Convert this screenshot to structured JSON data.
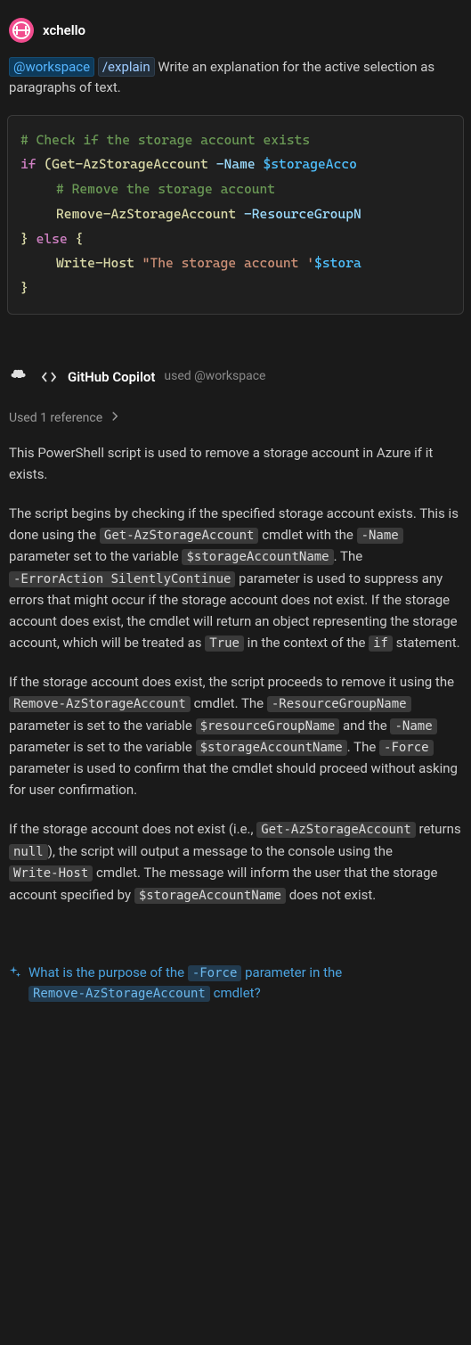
{
  "user": {
    "name": "xchello"
  },
  "prompt": {
    "workspace_tag": "@workspace",
    "slash_tag": "/explain",
    "text_after": " Write an explanation for the active selection as paragraphs of text."
  },
  "code": {
    "line1_comment": "# Check if the storage account exists",
    "line2_if": "if",
    "line2_open": " (",
    "line2_cmd": "Get-AzStorageAccount",
    "line2_param": " -Name ",
    "line2_var": "$storageAcco",
    "line3_comment": "# Remove the storage account",
    "line4_cmd": "Remove-AzStorageAccount",
    "line4_param": " -ResourceGroupN",
    "line5_close": "}",
    "line5_else": " else ",
    "line5_open": "{",
    "line6_cmd": "Write-Host",
    "line6_str_a": " \"The storage account '",
    "line6_var": "$stora",
    "line7_close": "}"
  },
  "copilot": {
    "name": "GitHub Copilot",
    "used": "used @workspace",
    "references": "Used 1 reference"
  },
  "explanation": {
    "p1": "This PowerShell script is used to remove a storage account in Azure if it exists.",
    "p2_a": "The script begins by checking if the specified storage account exists. This is done using the ",
    "p2_c1": "Get-AzStorageAccount",
    "p2_b": " cmdlet with the ",
    "p2_c2": "-Name",
    "p2_c": " parameter set to the variable ",
    "p2_c3": "$storageAccountName",
    "p2_d": ". The ",
    "p2_c4": "-ErrorAction SilentlyContinue",
    "p2_e": " parameter is used to suppress any errors that might occur if the storage account does not exist. If the storage account does exist, the cmdlet will return an object representing the storage account, which will be treated as ",
    "p2_c5": "True",
    "p2_f": " in the context of the ",
    "p2_c6": "if",
    "p2_g": " statement.",
    "p3_a": "If the storage account does exist, the script proceeds to remove it using the ",
    "p3_c1": "Remove-AzStorageAccount",
    "p3_b": " cmdlet. The ",
    "p3_c2": "-ResourceGroupName",
    "p3_c": " parameter is set to the variable ",
    "p3_c3": "$resourceGroupName",
    "p3_d": " and the ",
    "p3_c4": "-Name",
    "p3_e": " parameter is set to the variable ",
    "p3_c5": "$storageAccountName",
    "p3_f": ". The ",
    "p3_c6": "-Force",
    "p3_g": " parameter is used to confirm that the cmdlet should proceed without asking for user confirmation.",
    "p4_a": "If the storage account does not exist (i.e., ",
    "p4_c1": "Get-AzStorageAccount",
    "p4_b": " returns ",
    "p4_c2": "null",
    "p4_c": "), the script will output a message to the console using the ",
    "p4_c3": "Write-Host",
    "p4_d": " cmdlet. The message will inform the user that the storage account specified by ",
    "p4_c4": "$storageAccountName",
    "p4_e": " does not exist."
  },
  "suggestion": {
    "a": "What is the purpose of the ",
    "c1": "-Force",
    "b": " parameter in the ",
    "c2": "Remove-AzStorageAccount",
    "c": " cmdlet?"
  }
}
